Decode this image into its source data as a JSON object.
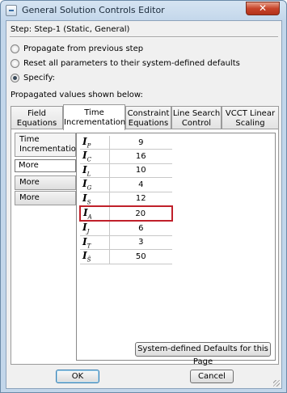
{
  "window": {
    "title": "General Solution Controls Editor",
    "close_label": "✕"
  },
  "step": {
    "label": "Step:  Step-1 (Static, General)"
  },
  "options": {
    "items": [
      {
        "label": "Propagate from previous step",
        "checked": false
      },
      {
        "label": "Reset all parameters to their system-defined defaults",
        "checked": false
      },
      {
        "label": "Specify:",
        "checked": true
      }
    ]
  },
  "propagated_label": "Propagated values shown below:",
  "tabs": [
    {
      "line1": "Field",
      "line2": "Equations",
      "active": false
    },
    {
      "line1": "Time",
      "line2": "Incrementation",
      "active": true
    },
    {
      "line1": "Constraint",
      "line2": "Equations",
      "active": false
    },
    {
      "line1": "Line Search",
      "line2": "Control",
      "active": false
    },
    {
      "line1": "VCCT Linear",
      "line2": "Scaling",
      "active": false
    }
  ],
  "side": {
    "first_line1": "Time",
    "first_line2": "Incrementation",
    "input_value": "More",
    "more1": "More",
    "more2": "More"
  },
  "params": [
    {
      "sym": "I",
      "sub": "P",
      "value": "9"
    },
    {
      "sym": "I",
      "sub": "C",
      "value": "16"
    },
    {
      "sym": "I",
      "sub": "L",
      "value": "10"
    },
    {
      "sym": "I",
      "sub": "G",
      "value": "4"
    },
    {
      "sym": "I",
      "sub": "S",
      "value": "12"
    },
    {
      "sym": "I",
      "sub": "A",
      "value": "20"
    },
    {
      "sym": "I",
      "sub": "J",
      "value": "6"
    },
    {
      "sym": "I",
      "sub": "T",
      "value": "3"
    },
    {
      "sym": "I",
      "sub": "S̃",
      "value": "50"
    }
  ],
  "defaults_button": "System-defined Defaults for this Page",
  "buttons": {
    "ok": "OK",
    "cancel": "Cancel"
  },
  "colors": {
    "highlight": "#c0202a",
    "title_bar": "#c2d6ea"
  }
}
